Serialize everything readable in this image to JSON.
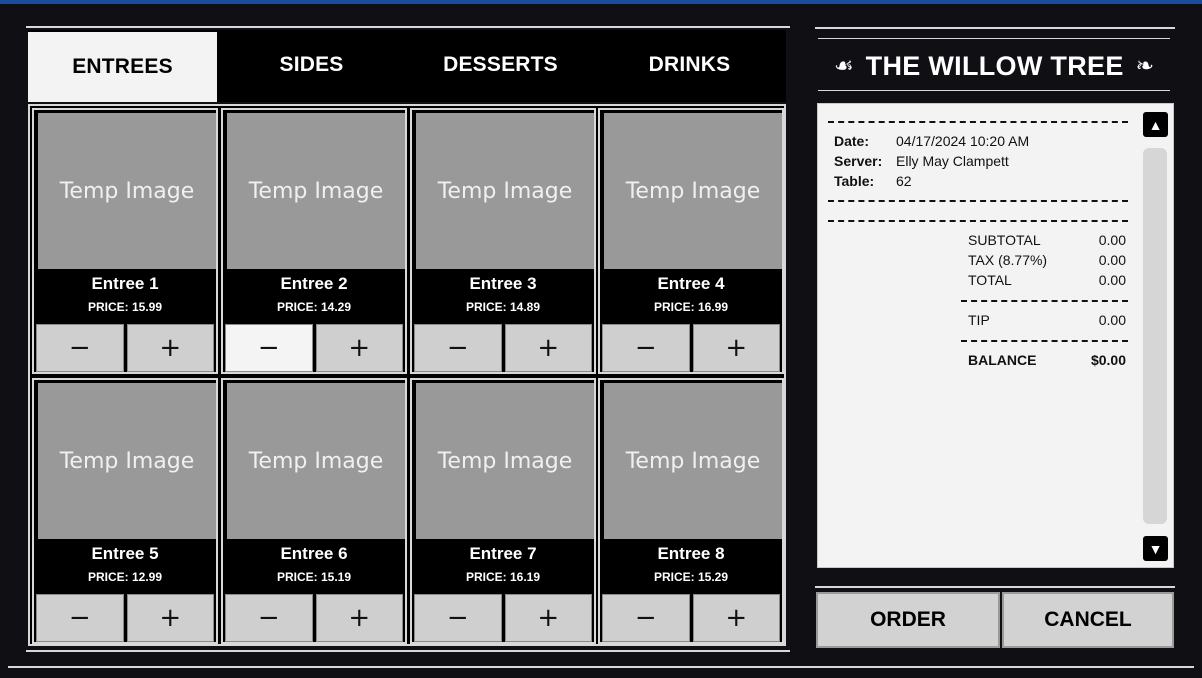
{
  "tabs": [
    "ENTREES",
    "SIDES",
    "DESSERTS",
    "DRINKS"
  ],
  "items": [
    {
      "image_text": "Temp Image",
      "name": "Entree 1",
      "price": "PRICE: 15.99"
    },
    {
      "image_text": "Temp Image",
      "name": "Entree 2",
      "price": "PRICE: 14.29"
    },
    {
      "image_text": "Temp Image",
      "name": "Entree 3",
      "price": "PRICE: 14.89"
    },
    {
      "image_text": "Temp Image",
      "name": "Entree 4",
      "price": "PRICE: 16.99"
    },
    {
      "image_text": "Temp Image",
      "name": "Entree 5",
      "price": "PRICE: 12.99"
    },
    {
      "image_text": "Temp Image",
      "name": "Entree 6",
      "price": "PRICE: 15.19"
    },
    {
      "image_text": "Temp Image",
      "name": "Entree 7",
      "price": "PRICE: 16.19"
    },
    {
      "image_text": "Temp Image",
      "name": "Entree 8",
      "price": "PRICE: 15.29"
    }
  ],
  "stepper": {
    "minus": "−",
    "plus": "+"
  },
  "restaurant": {
    "name": "THE WILLOW TREE",
    "ornament_left": "☙",
    "ornament_right": "❧"
  },
  "receipt": {
    "date_label": "Date:",
    "date_value": "04/17/2024 10:20 AM",
    "server_label": "Server:",
    "server_value": "Elly May Clampett",
    "table_label": "Table:",
    "table_value": "62",
    "subtotal_label": "SUBTOTAL",
    "subtotal_value": "0.00",
    "tax_label": "TAX (8.77%)",
    "tax_value": "0.00",
    "total_label": "TOTAL",
    "total_value": "0.00",
    "tip_label": "TIP",
    "tip_value": "0.00",
    "balance_label": "BALANCE",
    "balance_value": "$0.00",
    "scroll_up": "▲",
    "scroll_down": "▼"
  },
  "actions": {
    "order": "ORDER",
    "cancel": "CANCEL"
  },
  "colors": {
    "accent_top": "#1e4c9c",
    "background": "#101014",
    "placeholder": "#999999"
  }
}
